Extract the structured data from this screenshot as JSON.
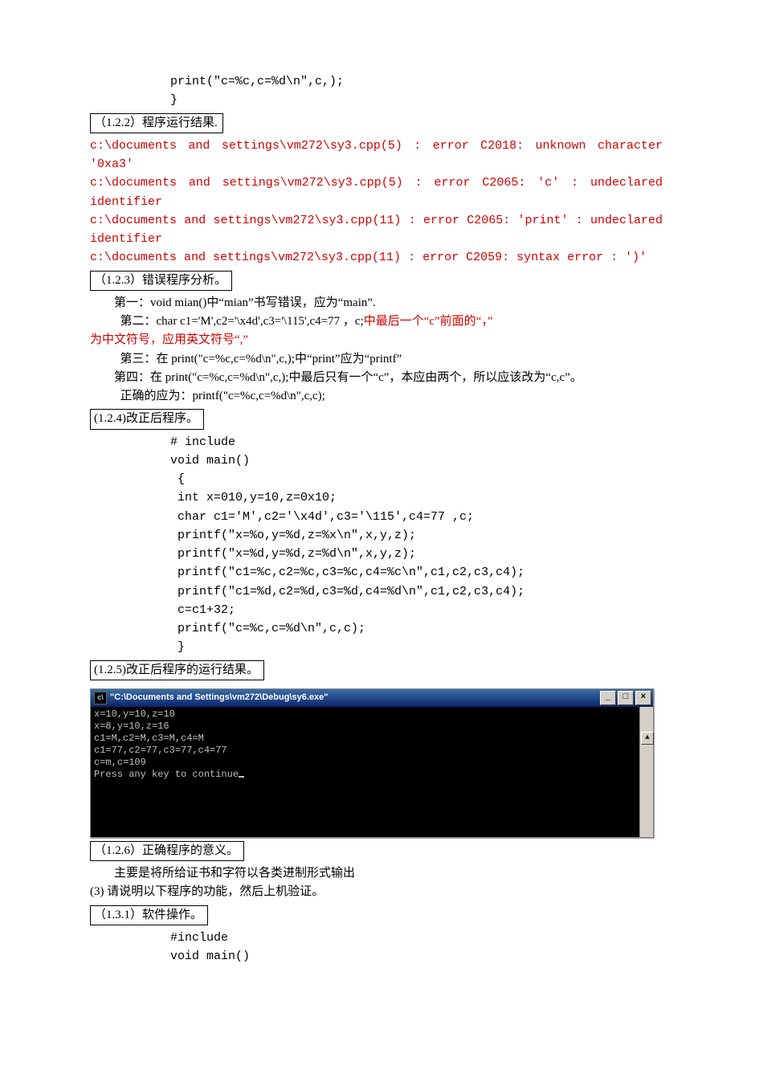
{
  "top_code": {
    "line1": "print(\"c=%c,c=%d\\n\",c,);",
    "line2": "}"
  },
  "sec_1_2_2": {
    "heading": "（1.2.2）程序运行结果.",
    "errors": [
      "c:\\documents and settings\\vm272\\sy3.cpp(5) : error C2018: unknown character '0xa3'",
      "c:\\documents  and  settings\\vm272\\sy3.cpp(5)  :  error  C2065:  'c'  :  undeclared identifier",
      "c:\\documents and settings\\vm272\\sy3.cpp(11) : error C2065: 'print' : undeclared identifier",
      "c:\\documents and settings\\vm272\\sy3.cpp(11) : error C2059: syntax error : ')'"
    ]
  },
  "sec_1_2_3": {
    "heading": "（1.2.3）错误程序分析。",
    "p1": "第一：void mian()中“mian”书写错误，应为“main”.",
    "p2_a": "第二：char c1='M',c2='\\x4d',c3='\\115',c4=77 ，c;",
    "p2_b": "中最后一个“c”前面的“，”",
    "p2_c": "为中文符号，应用英文符号“,”",
    "p3": "第三：在 print(\"c=%c,c=%d\\n\",c,);中“print”应为“printf”",
    "p4": "第四：在 print(\"c=%c,c=%d\\n\",c,);中最后只有一个“c”，本应由两个，所以应该改为“c,c”。",
    "p5": "正确的应为：printf(\"c=%c,c=%d\\n\",c,c);"
  },
  "sec_1_2_4": {
    "heading": "(1.2.4)改正后程序。",
    "code": [
      "# include",
      "void main()",
      " {",
      " int x=010,y=10,z=0x10;",
      " char c1='M',c2='\\x4d',c3='\\115',c4=77 ,c;",
      " printf(\"x=%o,y=%d,z=%x\\n\",x,y,z);",
      " printf(\"x=%d,y=%d,z=%d\\n\",x,y,z);",
      " printf(\"c1=%c,c2=%c,c3=%c,c4=%c\\n\",c1,c2,c3,c4);",
      " printf(\"c1=%d,c2=%d,c3=%d,c4=%d\\n\",c1,c2,c3,c4);",
      " c=c1+32;",
      " printf(\"c=%c,c=%d\\n\",c,c);",
      " }"
    ]
  },
  "sec_1_2_5": {
    "heading": "(1.2.5)改正后程序的运行结果。",
    "console": {
      "title": "\"C:\\Documents and Settings\\vm272\\Debug\\sy6.exe\"",
      "output": [
        "x=10,y=10,z=10",
        "x=8,y=10,z=16",
        "c1=M,c2=M,c3=M,c4=M",
        "c1=77,c2=77,c3=77,c4=77",
        "c=m,c=109",
        "Press any key to continue"
      ]
    }
  },
  "sec_1_2_6": {
    "heading": "（1.2.6）正确程序的意义。",
    "text": "主要是将所给证书和字符以各类进制形式输出"
  },
  "sec_3": {
    "text": "(3)   请说明以下程序的功能，然后上机验证。"
  },
  "sec_1_3_1": {
    "heading": "（1.3.1）软件操作。",
    "code": [
      "#include",
      "void main()"
    ]
  }
}
